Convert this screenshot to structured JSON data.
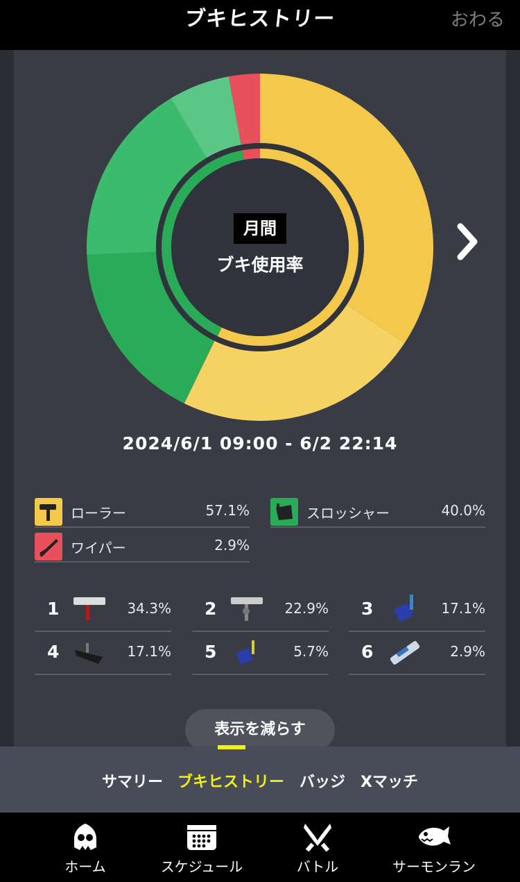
{
  "header": {
    "title": "ブキヒストリー",
    "close_label": "おわる"
  },
  "chart_data": {
    "type": "pie",
    "title": "ブキ使用率",
    "period_badge": "月間",
    "period_range": "2024/6/1 09:00 - 6/2 22:14",
    "inner_ring": [
      {
        "category": "ローラー",
        "value": 57.1,
        "color": "#f4c84a"
      },
      {
        "category": "スロッシャー",
        "value": 40.0,
        "color": "#2aab58"
      },
      {
        "category": "ワイパー",
        "value": 2.9,
        "color": "#e8505b"
      }
    ],
    "outer_ring": [
      {
        "rank": 1,
        "value": 34.3,
        "color": "#f4c84a",
        "weapon_icon": "carbon-roller-icon"
      },
      {
        "rank": 2,
        "value": 22.9,
        "color": "#f5d262",
        "weapon_icon": "dynamo-roller-icon"
      },
      {
        "rank": 3,
        "value": 17.1,
        "color": "#2aab58",
        "weapon_icon": "slosher-icon"
      },
      {
        "rank": 4,
        "value": 17.1,
        "color": "#3dbb6c",
        "weapon_icon": "explosher-icon"
      },
      {
        "rank": 5,
        "value": 5.7,
        "color": "#5bc787",
        "weapon_icon": "tri-slosher-icon"
      },
      {
        "rank": 6,
        "value": 2.9,
        "color": "#e8505b",
        "weapon_icon": "wiper-icon"
      }
    ]
  },
  "categories": [
    {
      "name": "ローラー",
      "pct": "57.1%",
      "color": "#f4c84a",
      "icon": "roller-class-icon"
    },
    {
      "name": "スロッシャー",
      "pct": "40.0%",
      "color": "#2aab58",
      "icon": "slosher-class-icon"
    },
    {
      "name": "ワイパー",
      "pct": "2.9%",
      "color": "#e8505b",
      "icon": "wiper-class-icon"
    }
  ],
  "weapons": [
    {
      "rank": "1",
      "pct": "34.3%"
    },
    {
      "rank": "2",
      "pct": "22.9%"
    },
    {
      "rank": "3",
      "pct": "17.1%"
    },
    {
      "rank": "4",
      "pct": "17.1%"
    },
    {
      "rank": "5",
      "pct": "5.7%"
    },
    {
      "rank": "6",
      "pct": "2.9%"
    }
  ],
  "less_button": "表示を減らす",
  "tabs": [
    {
      "label": "サマリー",
      "active": false
    },
    {
      "label": "ブキヒストリー",
      "active": true,
      "color": "#f0f014"
    },
    {
      "label": "バッジ",
      "active": false
    },
    {
      "label": "Xマッチ",
      "active": false
    }
  ],
  "nav": [
    {
      "label": "ホーム",
      "icon": "squid-home-icon"
    },
    {
      "label": "スケジュール",
      "icon": "calendar-icon"
    },
    {
      "label": "バトル",
      "icon": "battle-icon"
    },
    {
      "label": "サーモンラン",
      "icon": "salmon-icon"
    }
  ]
}
